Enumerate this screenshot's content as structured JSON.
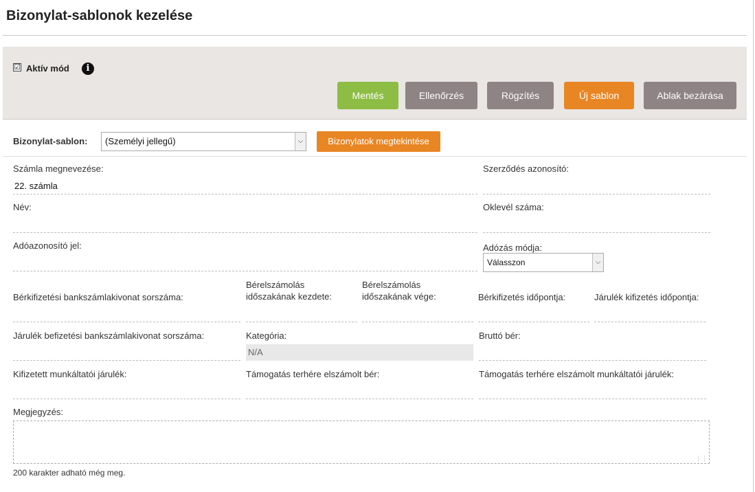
{
  "page": {
    "title": "Bizonylat-sablonok kezelése"
  },
  "toolbar": {
    "active_mode": {
      "label": "Aktív mód",
      "checked": true,
      "checkmark": "☑"
    },
    "info_icon": "i",
    "buttons": {
      "save": "Mentés",
      "check": "Ellenőrzés",
      "record": "Rögzítés",
      "new_template": "Új sablon",
      "close_window": "Ablak bezárása"
    },
    "colors": {
      "green": "#8ebd45",
      "gray": "#8e8385",
      "orange": "#e98624",
      "background": "#e9e6e3"
    }
  },
  "template": {
    "label": "Bizonylat-sablon:",
    "selected": "(Személyi jellegű)",
    "view_button": "Bizonylatok megtekintése"
  },
  "form": {
    "invoice_name": {
      "label": "Számla megnevezése:",
      "value": "22. számla"
    },
    "contract_id": {
      "label": "Szerződés azonosító:",
      "value": ""
    },
    "name": {
      "label": "Név:",
      "value": ""
    },
    "diploma_number": {
      "label": "Oklevél száma:",
      "value": ""
    },
    "tax_id": {
      "label": "Adóazonosító jel:",
      "value": ""
    },
    "taxation_mode": {
      "label": "Adózás módja:",
      "selected": "Válasszon"
    },
    "wage_statement_no": {
      "label": "Bérkifizetési bankszámlakivonat sorszáma:",
      "value": ""
    },
    "period_start": {
      "label_line1": "Bérelszámolás",
      "label_line2": "időszakának kezdete:",
      "value": ""
    },
    "period_end": {
      "label_line1": "Bérelszámolás",
      "label_line2": "időszakának vége:",
      "value": ""
    },
    "payment_date": {
      "label": "Bérkifizetés időpontja:",
      "value": ""
    },
    "contribution_date": {
      "label": "Járulék kifizetés időpontja:",
      "value": ""
    },
    "contribution_statement_no": {
      "label": "Járulék befizetési bankszámlakivonat sorszáma:",
      "value": ""
    },
    "category": {
      "label": "Kategória:",
      "value": "N/A"
    },
    "gross_wage": {
      "label": "Bruttó bér:",
      "value": ""
    },
    "employer_contribution": {
      "label": "Kifizetett munkáltatói járulék:",
      "value": ""
    },
    "subsidized_wage": {
      "label": "Támogatás terhére elszámolt bér:",
      "value": ""
    },
    "subsidized_employer_contribution": {
      "label": "Támogatás terhére elszámolt munkáltatói járulék:",
      "value": ""
    },
    "note": {
      "label": "Megjegyzés:",
      "value": "",
      "hint": "200 karakter adható még meg."
    }
  }
}
